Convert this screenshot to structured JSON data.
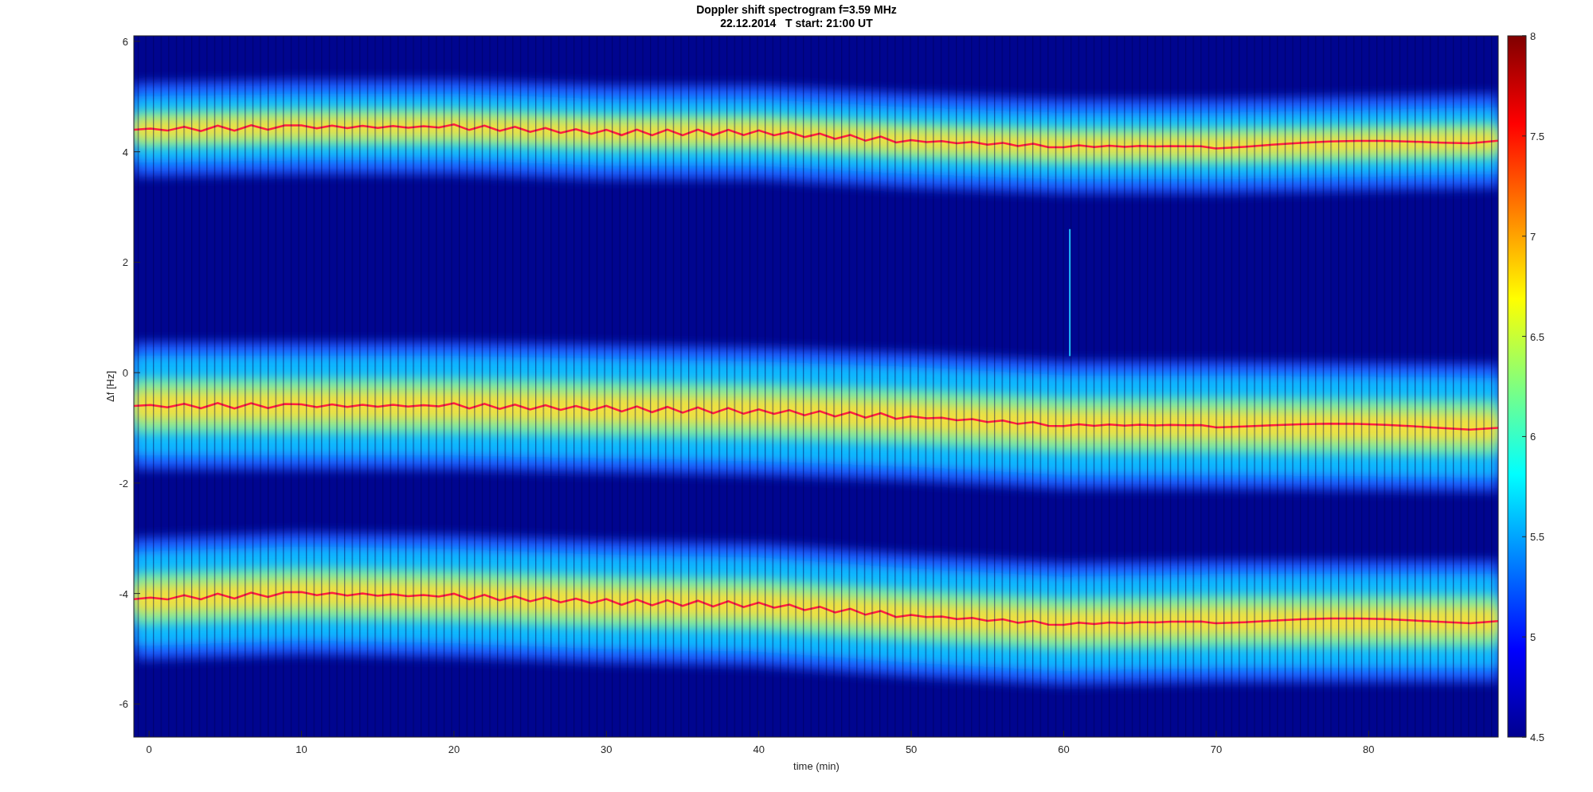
{
  "figure": {
    "title_lines": [
      "Doppler shift spectrogram f=3.59 MHz",
      "22.12.2014   T start: 21:00 UT"
    ],
    "xlabel": "time (min)",
    "ylabel": "Δf [Hz]",
    "xticks": [
      "0",
      "10",
      "20",
      "30",
      "40",
      "50",
      "60",
      "70",
      "80"
    ],
    "yticks": [
      "6",
      "4",
      "2",
      "0",
      "-2",
      "-4",
      "-6"
    ],
    "colorbar_ticks": [
      "8",
      "7.5",
      "7",
      "6.5",
      "6",
      "5.5",
      "5",
      "4.5"
    ]
  }
}
